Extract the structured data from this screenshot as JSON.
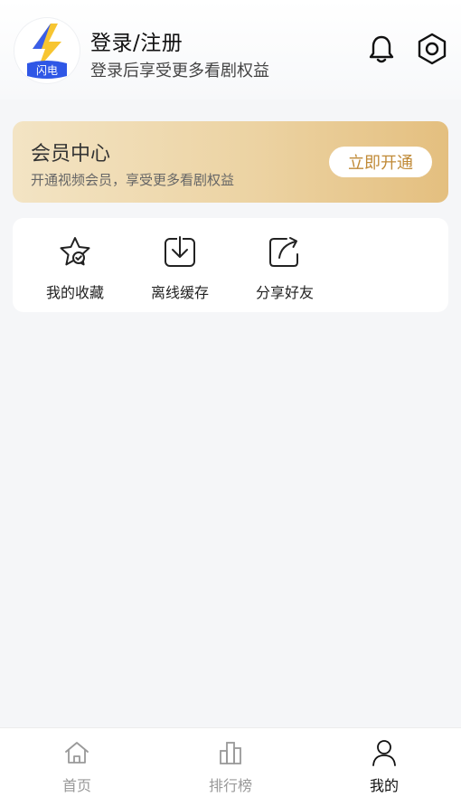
{
  "profile": {
    "title": "登录/注册",
    "subtitle": "登录后享受更多看剧权益",
    "logo_text": "闪电"
  },
  "vip": {
    "title": "会员中心",
    "subtitle": "开通视频会员，享受更多看剧权益",
    "button": "立即开通"
  },
  "quick_actions": [
    {
      "label": "我的收藏",
      "icon": "star-check-icon"
    },
    {
      "label": "离线缓存",
      "icon": "download-icon"
    },
    {
      "label": "分享好友",
      "icon": "share-icon"
    }
  ],
  "tabs": [
    {
      "label": "首页",
      "icon": "home-icon",
      "active": false
    },
    {
      "label": "排行榜",
      "icon": "ranking-icon",
      "active": false
    },
    {
      "label": "我的",
      "icon": "user-icon",
      "active": true
    }
  ],
  "colors": {
    "vip_button_text": "#c08a37",
    "active_tab": "#111111",
    "inactive_tab": "#999999"
  }
}
